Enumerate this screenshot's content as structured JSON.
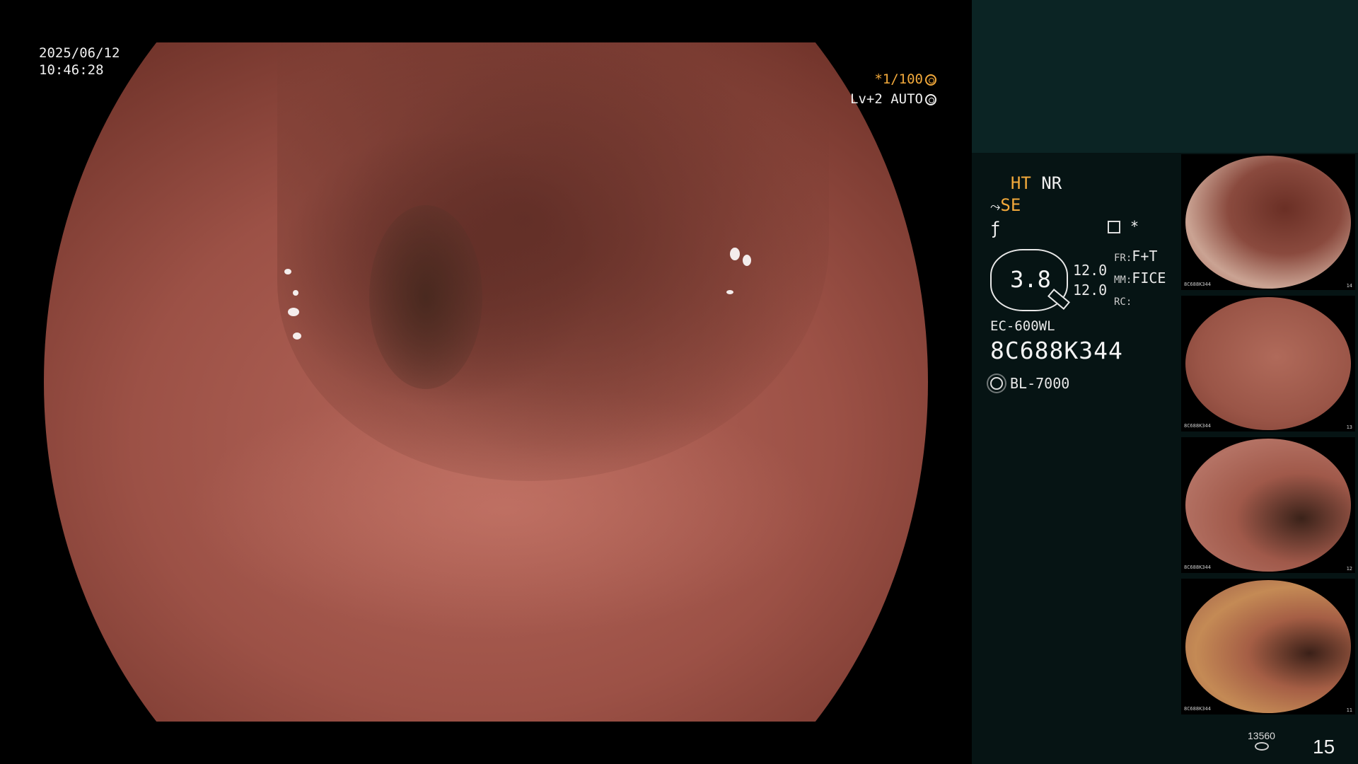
{
  "overlay": {
    "date": "2025/06/12",
    "time": "10:46:28",
    "shutter": "*1/100",
    "level": "Lv+2 AUTO"
  },
  "status": {
    "ht": "HT",
    "nr": "NR",
    "se": "SE",
    "f_symbol": "ƒ",
    "star": "*"
  },
  "gauge": {
    "value": "3.8"
  },
  "params": {
    "val1": "12.0",
    "val2": "12.0",
    "fr_label": "FR:",
    "fr_value": "F+T",
    "mm_label": "MM:",
    "mm_value": "FICE",
    "rc_label": "RC:",
    "rc_value": ""
  },
  "scope": {
    "model": "EC-600WL",
    "serial": "8C688K344",
    "light": "BL-7000"
  },
  "thumbnails": [
    {
      "info": "8C688K344",
      "num": "14"
    },
    {
      "info": "8C688K344",
      "num": "13"
    },
    {
      "info": "8C688K344",
      "num": "12"
    },
    {
      "info": "8C688K344",
      "num": "11"
    }
  ],
  "counters": {
    "storage": "13560",
    "image_count": "15"
  },
  "colors": {
    "accent": "#f2a93b",
    "panel_bg": "#061414",
    "panel_top": "#0b2424"
  }
}
